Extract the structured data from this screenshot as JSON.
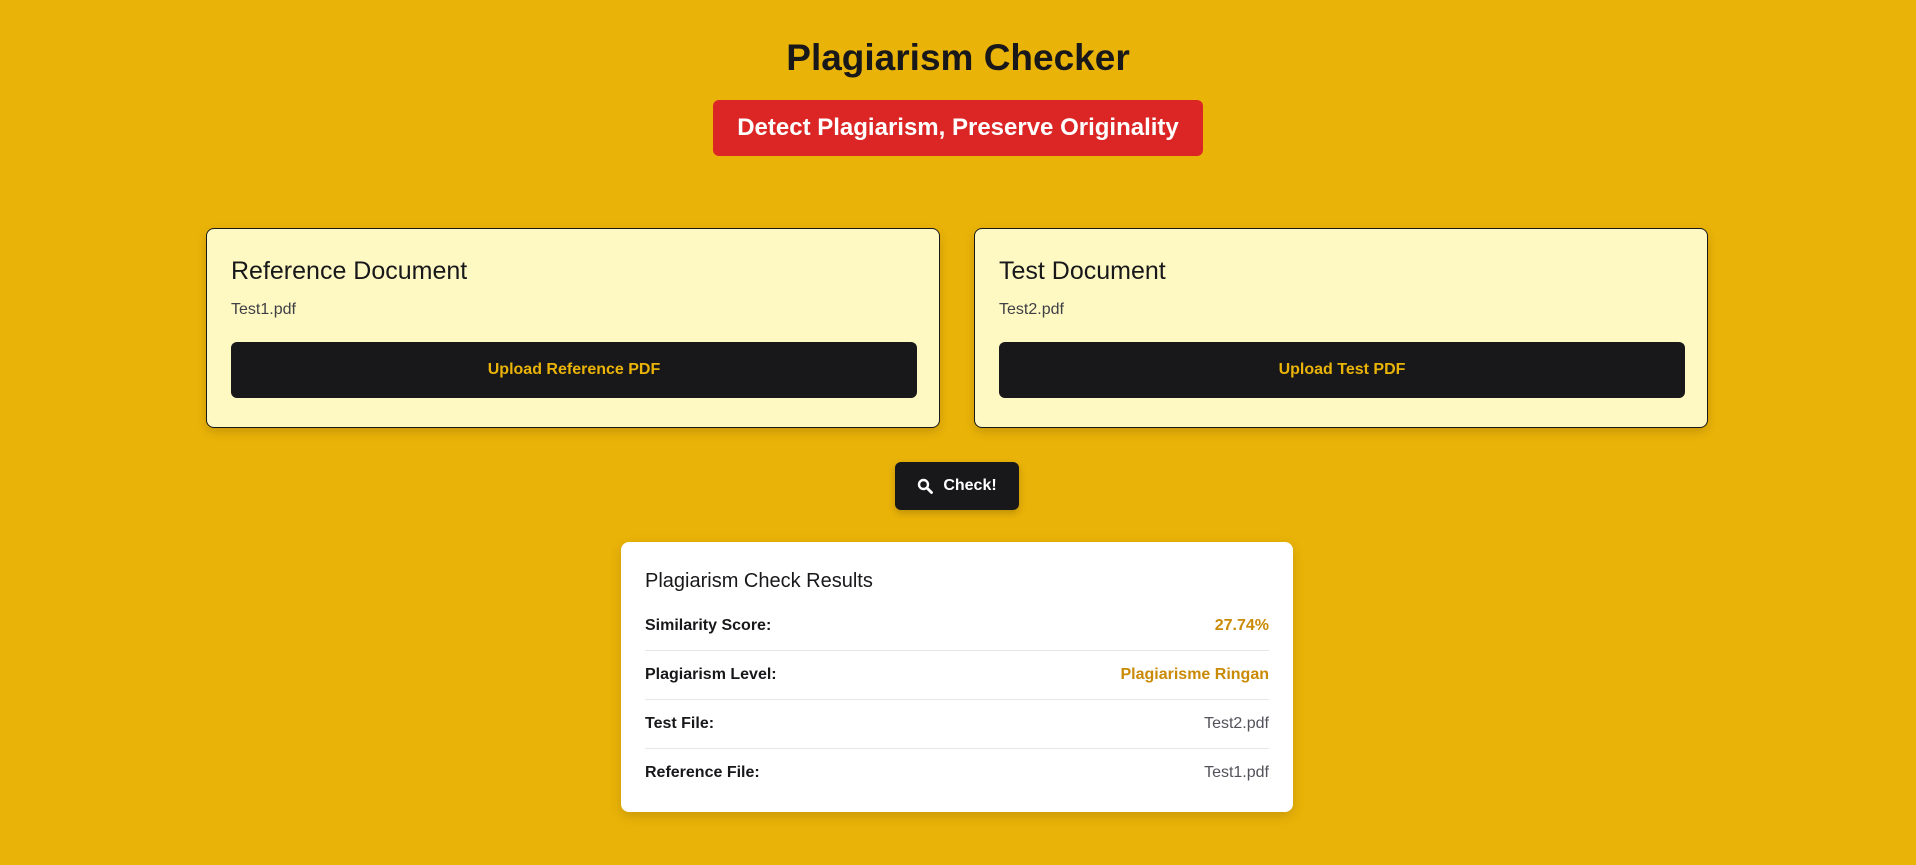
{
  "header": {
    "title": "Plagiarism Checker",
    "tagline": "Detect Plagiarism, Preserve Originality"
  },
  "reference": {
    "title": "Reference Document",
    "file_name": "Test1.pdf",
    "upload_label": "Upload Reference PDF"
  },
  "test": {
    "title": "Test Document",
    "file_name": "Test2.pdf",
    "upload_label": "Upload Test PDF"
  },
  "check_button": {
    "label": "Check!",
    "icon": "search-icon"
  },
  "results": {
    "title": "Plagiarism Check Results",
    "rows": [
      {
        "label": "Similarity Score:",
        "value": "27.74%"
      },
      {
        "label": "Plagiarism Level:",
        "value": "Plagiarisme Ringan"
      },
      {
        "label": "Test File:",
        "value": "Test2.pdf"
      },
      {
        "label": "Reference File:",
        "value": "Test1.pdf"
      }
    ]
  },
  "colors": {
    "background": "#eab308",
    "tagline_bg": "#dc2626",
    "card_bg": "#fef9c3",
    "button_bg": "#18181b",
    "accent_text": "#ca8a04"
  }
}
